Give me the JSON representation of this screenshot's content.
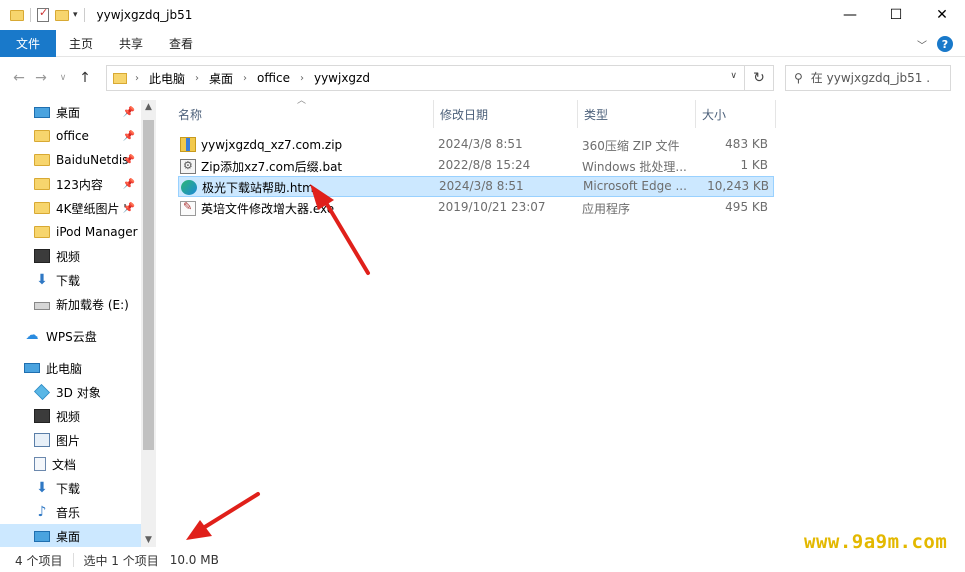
{
  "window": {
    "title": "yywjxgzdq_jb51",
    "controls": {
      "minimize": "—",
      "maximize": "☐",
      "close": "✕"
    }
  },
  "ribbon": {
    "tabs": [
      {
        "label": "文件",
        "active": true
      },
      {
        "label": "主页"
      },
      {
        "label": "共享"
      },
      {
        "label": "查看"
      }
    ],
    "help": "?"
  },
  "address": {
    "crumbs": [
      "此电脑",
      "桌面",
      "office",
      "yywjxgzd"
    ],
    "search_placeholder": "在 yywjxgzdq_jb51 ..."
  },
  "nav": {
    "items": [
      {
        "label": "桌面",
        "icon": "desktop-icon",
        "pinned": true
      },
      {
        "label": "office",
        "icon": "folder-icon",
        "pinned": true
      },
      {
        "label": "BaiduNetdis",
        "icon": "folder-icon",
        "pinned": true
      },
      {
        "label": "123内容",
        "icon": "folder-icon",
        "pinned": true
      },
      {
        "label": "4K壁纸图片 '",
        "icon": "folder-icon",
        "pinned": true
      },
      {
        "label": "iPod Manager",
        "icon": "folder-icon"
      },
      {
        "label": "视频",
        "icon": "video-icon"
      },
      {
        "label": "下载",
        "icon": "download-icon"
      },
      {
        "label": "新加载卷 (E:)",
        "icon": "drive-icon"
      },
      {
        "label": "WPS云盘",
        "icon": "cloud-icon"
      },
      {
        "label": "此电脑",
        "icon": "computer-icon"
      },
      {
        "label": "3D 对象",
        "icon": "3d-objects-icon"
      },
      {
        "label": "视频",
        "icon": "video-icon"
      },
      {
        "label": "图片",
        "icon": "pictures-icon"
      },
      {
        "label": "文档",
        "icon": "documents-icon"
      },
      {
        "label": "下载",
        "icon": "download-icon"
      },
      {
        "label": "音乐",
        "icon": "music-icon"
      },
      {
        "label": "桌面",
        "icon": "desktop-icon",
        "selected": true
      }
    ]
  },
  "columns": {
    "name": "名称",
    "date": "修改日期",
    "type": "类型",
    "size": "大小"
  },
  "files": [
    {
      "name": "yywjxgzdq_xz7.com.zip",
      "date": "2024/3/8 8:51",
      "type": "360压缩 ZIP 文件",
      "size": "483 KB",
      "icon": "zip-icon"
    },
    {
      "name": "Zip添加xz7.com后缀.bat",
      "date": "2022/8/8 15:24",
      "type": "Windows 批处理...",
      "size": "1 KB",
      "icon": "bat-icon"
    },
    {
      "name": "极光下载站帮助.htm",
      "date": "2024/3/8 8:51",
      "type": "Microsoft Edge ...",
      "size": "10,243 KB",
      "icon": "edge-icon",
      "selected": true
    },
    {
      "name": "英培文件修改增大器.exe",
      "date": "2019/10/21 23:07",
      "type": "应用程序",
      "size": "495 KB",
      "icon": "exe-icon"
    }
  ],
  "status": {
    "count": "4 个项目",
    "selected": "选中 1 个项目",
    "size": "10.0 MB"
  },
  "watermark": "www.9a9m.com",
  "colors": {
    "accent": "#1979ca",
    "selection": "#cce8ff",
    "arrow": "#e0201a",
    "watermark": "#e3b800"
  }
}
